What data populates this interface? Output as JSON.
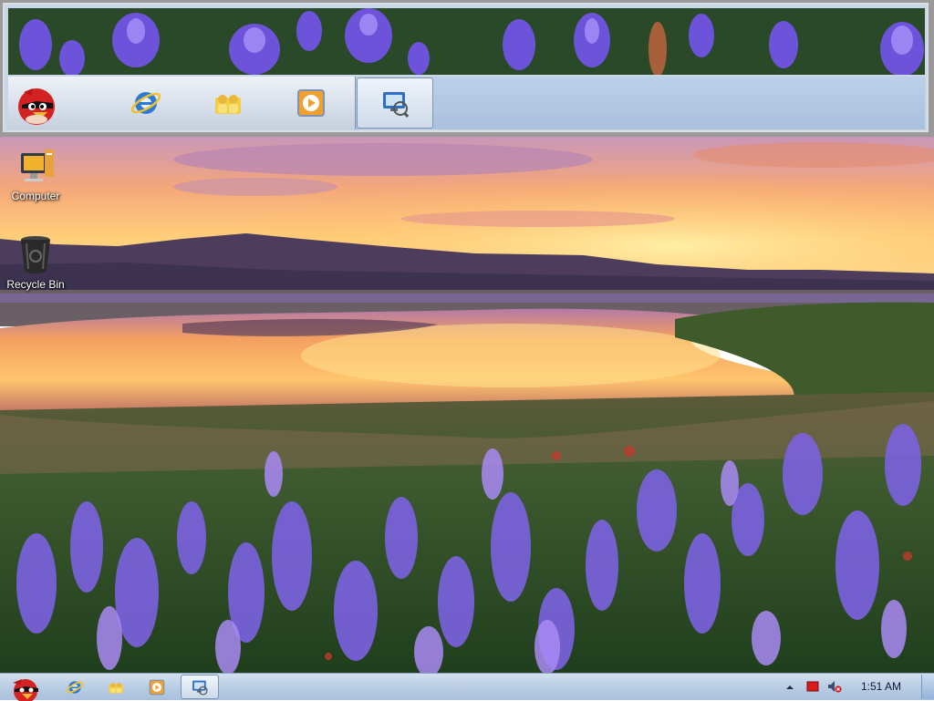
{
  "desktop": {
    "icons": [
      {
        "label": "Computer",
        "icon": "computer-icon"
      },
      {
        "label": "Recycle Bin",
        "icon": "recycle-bin-icon"
      }
    ]
  },
  "preview_panel": {
    "items": [
      {
        "icon": "start-bird-icon"
      },
      {
        "icon": "internet-explorer-icon"
      },
      {
        "icon": "users-folder-icon"
      },
      {
        "icon": "media-player-icon"
      },
      {
        "icon": "network-window-icon",
        "active": true
      }
    ]
  },
  "taskbar": {
    "pinned": [
      {
        "icon": "start-bird-icon"
      },
      {
        "icon": "internet-explorer-icon"
      },
      {
        "icon": "users-folder-icon"
      },
      {
        "icon": "media-player-icon"
      },
      {
        "icon": "network-window-icon",
        "active": true
      }
    ],
    "tray": {
      "icons": [
        "show-hidden-icons-arrow",
        "red-flag-icon",
        "volume-muted-icon"
      ],
      "clock": "1:51 AM"
    }
  },
  "colors": {
    "taskbar": "#b9cde4",
    "sky_top": "#c8a0c0",
    "sunset": "#ffb347",
    "flowers": "#7a5cd8"
  }
}
